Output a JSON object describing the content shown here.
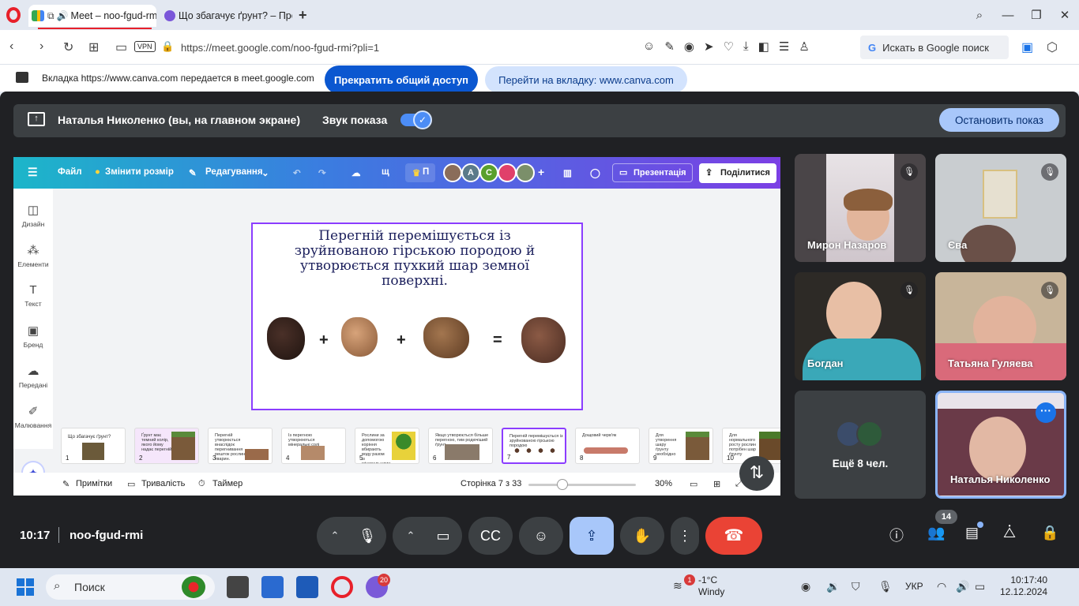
{
  "browser": {
    "tabs": [
      {
        "title": "Meet – noo-fgud-rmi",
        "active": true
      },
      {
        "title": "Що збагачує ґрунт? – Пре",
        "active": false
      }
    ],
    "url": "https://meet.google.com/noo-fgud-rmi?pli=1",
    "vpn_label": "VPN",
    "search_placeholder": "Искать в Google поиск"
  },
  "share_banner": {
    "text": "Вкладка https://www.canva.com передается в meet.google.com",
    "stop_button": "Прекратить общий доступ",
    "goto_button": "Перейти на вкладку: www.canva.com"
  },
  "presenting_bar": {
    "presenter": "Наталья Николенко (вы, на главном экране)",
    "sound_label": "Звук показа",
    "sound_on": true,
    "stop_button": "Остановить показ"
  },
  "canva": {
    "topbar": {
      "file": "Файл",
      "resize": "Змінити розмір",
      "editing": "Редагування",
      "letter": "щ",
      "pro_label": "П",
      "collab_initials": [
        "A",
        "C"
      ],
      "present": "Презентація",
      "share": "Поділитися"
    },
    "rail": [
      "Дизайн",
      "Елементи",
      "Текст",
      "Бренд",
      "Передані",
      "Малювання"
    ],
    "slide_text": "Перегній перемішується із зруйнованою гірською породою й утворюється пухкий шар земної поверхні.",
    "operators": [
      "+",
      "+",
      "="
    ],
    "thumbnails": [
      {
        "num": "1",
        "text": "Що збагачує ґрунт?"
      },
      {
        "num": "2",
        "text": "Ґрунт має темний колір, якого йому надає перегній."
      },
      {
        "num": "3",
        "text": "Перегній утворюється внаслідок перегнивання решток рослин, тварин."
      },
      {
        "num": "4",
        "text": "Із перегною утворюються мінеральні солі"
      },
      {
        "num": "5",
        "text": "Рослини за допомогою коріння вбирають воду разом із мінеральними солями"
      },
      {
        "num": "6",
        "text": "Якщо утворюється більше перегною, тим родючіший ґрунт"
      },
      {
        "num": "7",
        "text": "Перегній перемішується із зруйнованою гірською породою"
      },
      {
        "num": "8",
        "text": "Дощовий черв'як"
      },
      {
        "num": "9",
        "text": "Для утворення шару ґрунту необхідно"
      },
      {
        "num": "10",
        "text": "Для нормального росту рослин потрібен шар ґрунту"
      }
    ],
    "bottom": {
      "notes": "Примітки",
      "duration": "Тривалість",
      "timer": "Таймер",
      "page": "Сторінка 7 з 33",
      "zoom": "30%",
      "zoom_fraction": 0.3
    }
  },
  "participants": [
    {
      "name": "Мирон Назаров",
      "muted": true
    },
    {
      "name": "Єва",
      "muted": true
    },
    {
      "name": "Богдан",
      "muted": true
    },
    {
      "name": "Татьяна Гуляева",
      "muted": true
    },
    {
      "name": "Наталья Николенко",
      "self": true
    }
  ],
  "more_participants": "Ещё 8 чел.",
  "controls": {
    "time": "10:17",
    "meeting_code": "noo-fgud-rmi",
    "people_count": "14"
  },
  "taskbar": {
    "search": "Поиск",
    "teams_badge": "20",
    "weather_badge": "1",
    "temperature": "-1°C",
    "weather": "Windy",
    "language": "УКР",
    "time": "10:17:40",
    "date": "12.12.2024"
  },
  "colors": {
    "meet_bg": "#202124",
    "primary_blue": "#0b57d0",
    "end_call_red": "#ea4335",
    "canva_purple": "#8b3dff"
  }
}
